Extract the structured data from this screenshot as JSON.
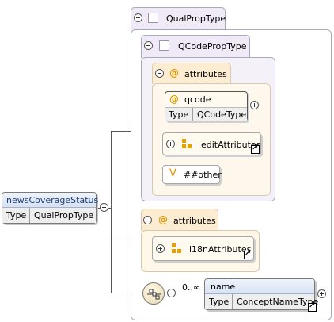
{
  "root_element": {
    "name": "newsCoverageStatus",
    "type_label": "Type",
    "type_value": "QualPropType"
  },
  "qualprop": {
    "title": "QualPropType"
  },
  "qcodeprop": {
    "title": "QCodePropType"
  },
  "inner_attributes": {
    "title": "attributes",
    "qcode": {
      "name": "qcode",
      "type_label": "Type",
      "type_value": "QCodeType"
    },
    "edit_attributes": "editAttributes",
    "other": "##other"
  },
  "outer_attributes": {
    "title": "attributes",
    "i18n": "i18nAttributes"
  },
  "sequence": {
    "cardinality": "0..∞",
    "name_element": {
      "name": "name",
      "type_label": "Type",
      "type_value": "ConceptNameType"
    }
  }
}
